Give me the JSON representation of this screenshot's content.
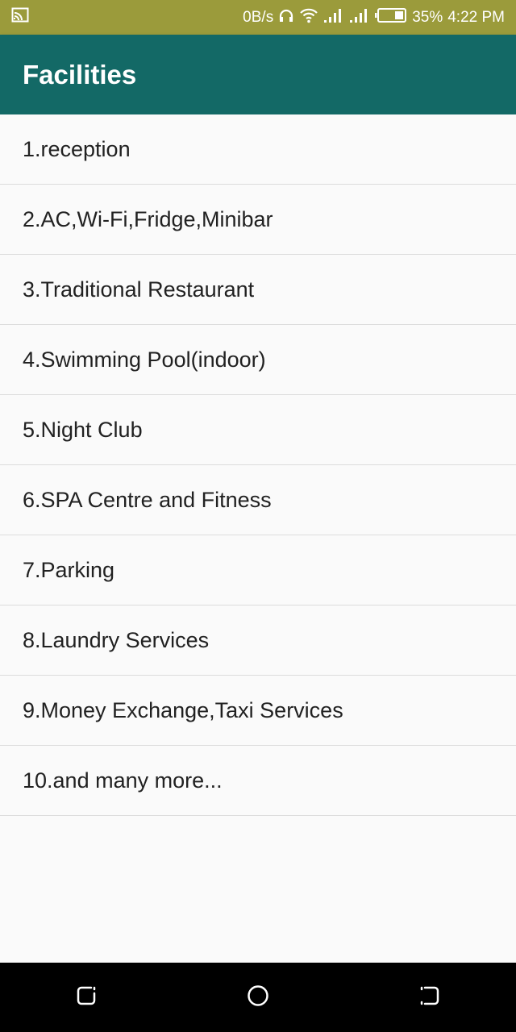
{
  "status_bar": {
    "net_speed": "0B/s",
    "battery_percent": "35%",
    "time": "4:22 PM",
    "background_color": "#9b9b3b",
    "icons": [
      "cast-icon",
      "headphones-icon",
      "wifi-icon",
      "signal-icon",
      "signal-icon",
      "battery-icon"
    ]
  },
  "app_bar": {
    "title": "Facilities",
    "background_color": "#136966"
  },
  "facilities": [
    "1.reception",
    "2.AC,Wi-Fi,Fridge,Minibar",
    "3.Traditional Restaurant",
    "4.Swimming Pool(indoor)",
    "5.Night Club",
    "6.SPA Centre and Fitness",
    "7.Parking",
    "8.Laundry Services",
    "9.Money Exchange,Taxi Services",
    "10.and many more..."
  ],
  "nav_bar": {
    "buttons": [
      "recent-apps-icon",
      "home-icon",
      "back-icon"
    ]
  }
}
